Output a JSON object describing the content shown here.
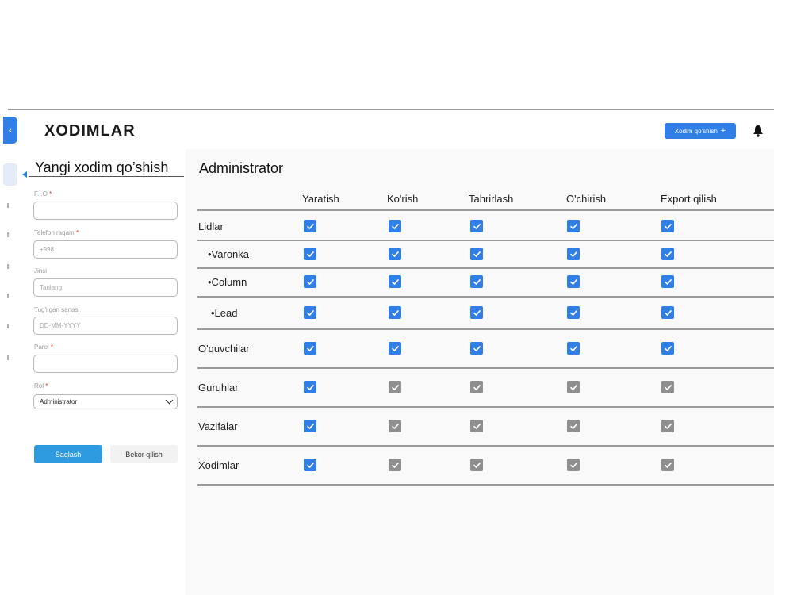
{
  "header": {
    "title": "XODIMLAR",
    "add_button": "Xodim qo'shish",
    "add_icon": "+"
  },
  "form": {
    "title": "Yangi xodim qo’shish",
    "fields": [
      {
        "label": "F.I.O",
        "required": true,
        "value": "",
        "placeholder": ""
      },
      {
        "label": "Telefon raqam",
        "required": true,
        "value": "",
        "placeholder": "+998"
      },
      {
        "label": "Jinsi",
        "required": false,
        "value": "",
        "placeholder": "Tanlang"
      },
      {
        "label": "Tug'ilgan sanasi",
        "required": false,
        "value": "",
        "placeholder": "DD-MM-YYYY"
      },
      {
        "label": "Parol",
        "required": true,
        "value": "",
        "placeholder": ""
      },
      {
        "label": "Rol",
        "required": true,
        "value": "Administrator",
        "placeholder": ""
      }
    ],
    "required_mark": "*",
    "save_label": "Saqlash",
    "cancel_label": "Bekor qilish"
  },
  "permissions": {
    "role_title": "Administrator",
    "columns": [
      "Yaratish",
      "Ko'rish",
      "Tahrirlash",
      "O'chirish",
      "Export qilish"
    ],
    "rows": [
      {
        "label": "Lidlar",
        "states": [
          "on",
          "on",
          "on",
          "on",
          "on"
        ]
      },
      {
        "label": "•Varonka",
        "states": [
          "on",
          "on",
          "on",
          "on",
          "on"
        ]
      },
      {
        "label": "•Column",
        "states": [
          "on",
          "on",
          "on",
          "on",
          "on"
        ]
      },
      {
        "label": "•Lead",
        "states": [
          "on",
          "on",
          "on",
          "on",
          "on"
        ]
      },
      {
        "label": "O'quvchilar",
        "states": [
          "on",
          "on",
          "on",
          "on",
          "on"
        ]
      },
      {
        "label": "Guruhlar",
        "states": [
          "on",
          "off",
          "off",
          "off",
          "off"
        ]
      },
      {
        "label": "Vazifalar",
        "states": [
          "on",
          "off",
          "off",
          "off",
          "off"
        ]
      },
      {
        "label": "Xodimlar",
        "states": [
          "on",
          "off",
          "off",
          "off",
          "off"
        ]
      }
    ]
  },
  "colors": {
    "accent": "#2f7fe6",
    "checked": "#2f7fe6",
    "disabled": "#8f8f8f"
  }
}
